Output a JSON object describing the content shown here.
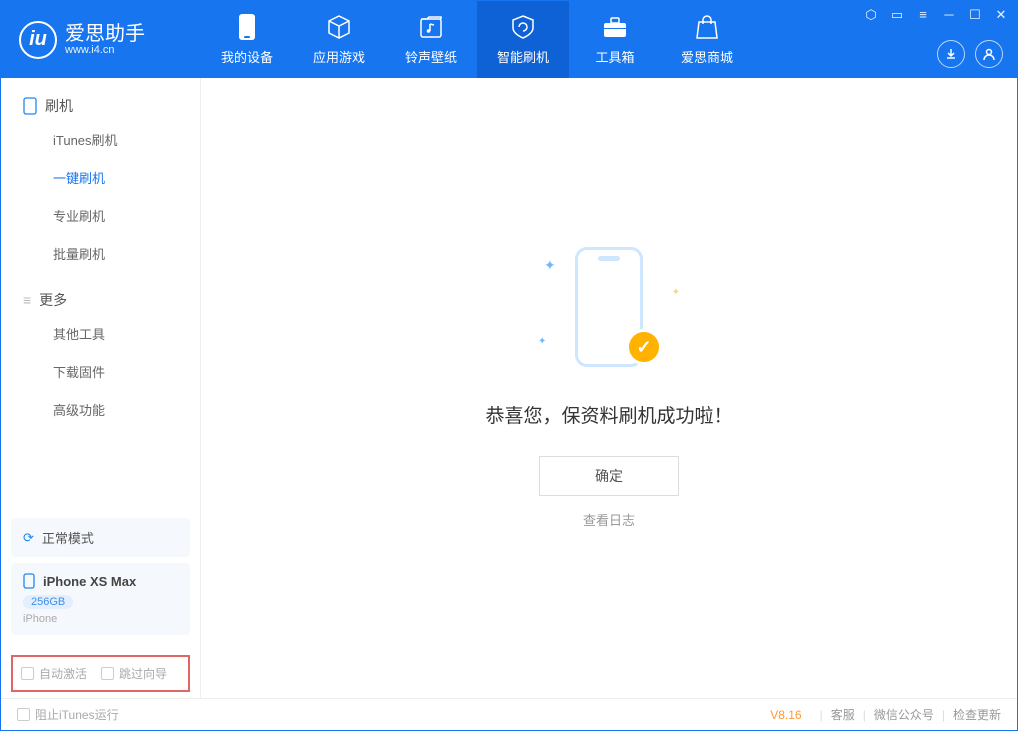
{
  "app": {
    "name": "爱思助手",
    "url": "www.i4.cn"
  },
  "tabs": [
    {
      "label": "我的设备"
    },
    {
      "label": "应用游戏"
    },
    {
      "label": "铃声壁纸"
    },
    {
      "label": "智能刷机"
    },
    {
      "label": "工具箱"
    },
    {
      "label": "爱思商城"
    }
  ],
  "sidebar": {
    "section1": "刷机",
    "items1": [
      "iTunes刷机",
      "一键刷机",
      "专业刷机",
      "批量刷机"
    ],
    "section2": "更多",
    "items2": [
      "其他工具",
      "下载固件",
      "高级功能"
    ]
  },
  "device": {
    "mode": "正常模式",
    "name": "iPhone XS Max",
    "storage": "256GB",
    "type": "iPhone"
  },
  "checkboxes": {
    "auto_activate": "自动激活",
    "skip_guide": "跳过向导"
  },
  "main": {
    "success_msg": "恭喜您，保资料刷机成功啦！",
    "ok": "确定",
    "view_log": "查看日志"
  },
  "footer": {
    "block_itunes": "阻止iTunes运行",
    "version": "V8.16",
    "support": "客服",
    "wechat": "微信公众号",
    "update": "检查更新"
  }
}
